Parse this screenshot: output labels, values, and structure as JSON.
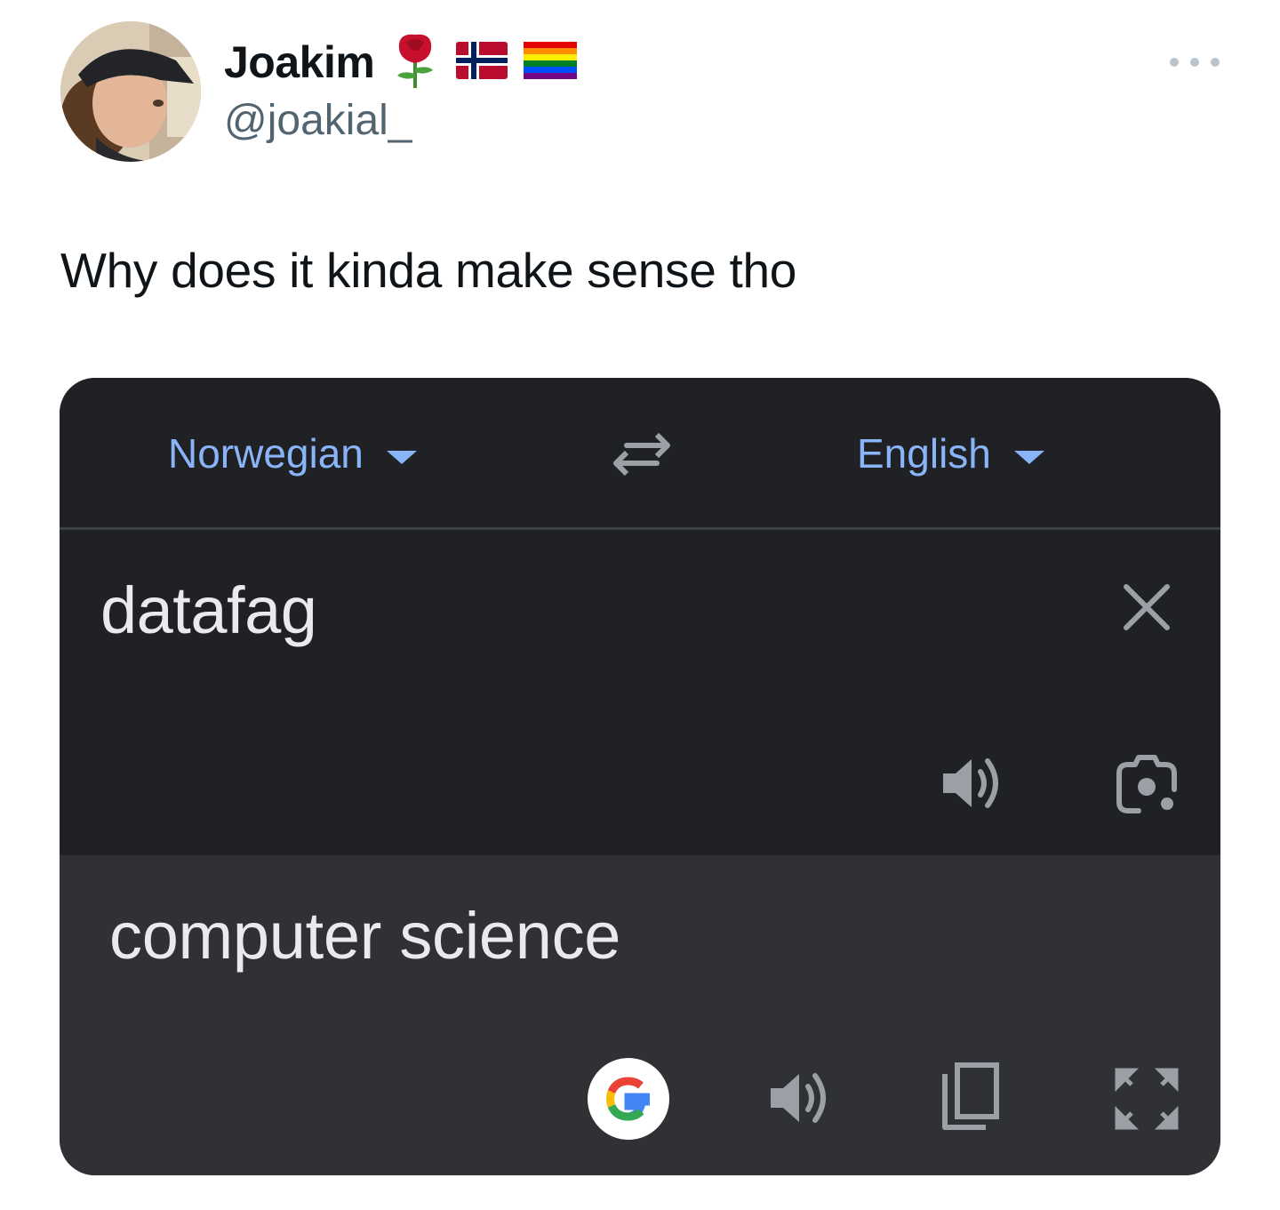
{
  "author": {
    "display_name": "Joakim",
    "handle": "@joakial_",
    "emoji": [
      "rose-icon",
      "norway-flag-icon",
      "rainbow-flag-icon"
    ]
  },
  "more_menu": "more-options-icon",
  "tweet": {
    "text": "Why does it kinda make sense tho"
  },
  "translate": {
    "source_language": "Norwegian",
    "target_language": "English",
    "source_text": "datafag",
    "result_text": "computer science",
    "colors": {
      "background": "#202124",
      "result_background": "#303134",
      "accent": "#8ab4f8",
      "text": "#e8eaed",
      "icon": "#9aa0a6"
    }
  }
}
